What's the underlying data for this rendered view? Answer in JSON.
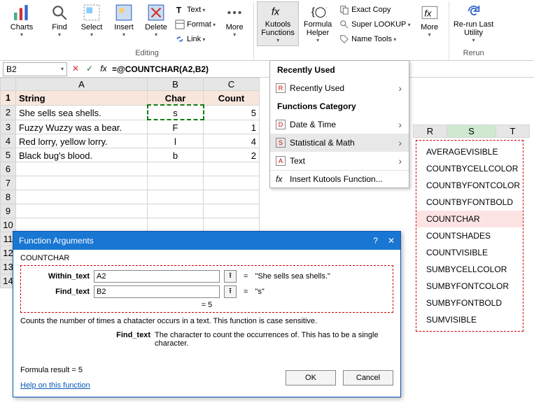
{
  "ribbon": {
    "charts": "Charts",
    "find": "Find",
    "select": "Select",
    "insert": "Insert",
    "delete": "Delete",
    "text": "Text",
    "format": "Format",
    "link": "Link",
    "more": "More",
    "kutools_functions": "Kutools Functions",
    "formula_helper": "Formula Helper",
    "exact_copy": "Exact Copy",
    "super_lookup": "Super LOOKUP",
    "name_tools": "Name Tools",
    "more2": "More",
    "rerun": "Re-run Last Utility",
    "group_editing": "Editing",
    "group_rerun": "Rerun"
  },
  "namebox": "B2",
  "formula": "=@COUNTCHAR(A2,B2)",
  "columns": [
    "A",
    "B",
    "C"
  ],
  "extra_cols": [
    "R",
    "S",
    "T"
  ],
  "headers": {
    "A": "String",
    "B": "Char",
    "C": "Count"
  },
  "rows": [
    {
      "n": "2",
      "A": "She sells sea shells.",
      "B": "s",
      "C": "5"
    },
    {
      "n": "3",
      "A": "Fuzzy Wuzzy was a bear.",
      "B": "F",
      "C": "1"
    },
    {
      "n": "4",
      "A": "Red lorry, yellow lorry.",
      "B": "l",
      "C": "4"
    },
    {
      "n": "5",
      "A": "Black bug's blood.",
      "B": "b",
      "C": "2"
    }
  ],
  "blank_rows": [
    "6",
    "7",
    "8",
    "9",
    "10",
    "11",
    "12",
    "13",
    "14"
  ],
  "menu": {
    "recently_used_hdr": "Recently Used",
    "recently_used": "Recently Used",
    "category_hdr": "Functions Category",
    "date_time": "Date & Time",
    "stat_math": "Statistical & Math",
    "text": "Text",
    "insert_fn": "Insert Kutools Function..."
  },
  "functions": [
    "AVERAGEVISIBLE",
    "COUNTBYCELLCOLOR",
    "COUNTBYFONTCOLOR",
    "COUNTBYFONTBOLD",
    "COUNTCHAR",
    "COUNTSHADES",
    "COUNTVISIBLE",
    "SUMBYCELLCOLOR",
    "SUMBYFONTCOLOR",
    "SUMBYFONTBOLD",
    "SUMVISIBLE"
  ],
  "dialog": {
    "title": "Function Arguments",
    "fname": "COUNTCHAR",
    "arg1_label": "Within_text",
    "arg1_value": "A2",
    "arg1_result": "\"She sells sea shells.\"",
    "arg2_label": "Find_text",
    "arg2_value": "B2",
    "arg2_result": "\"s\"",
    "result_eq": "=   5",
    "desc": "Counts the number of times a chatacter occurs in a text. This function is case sensitive.",
    "desc2_label": "Find_text",
    "desc2_text": "The character to count the occurrences of. This has to be a single character.",
    "formula_result_label": "Formula result =   5",
    "help": "Help on this function",
    "ok": "OK",
    "cancel": "Cancel"
  }
}
